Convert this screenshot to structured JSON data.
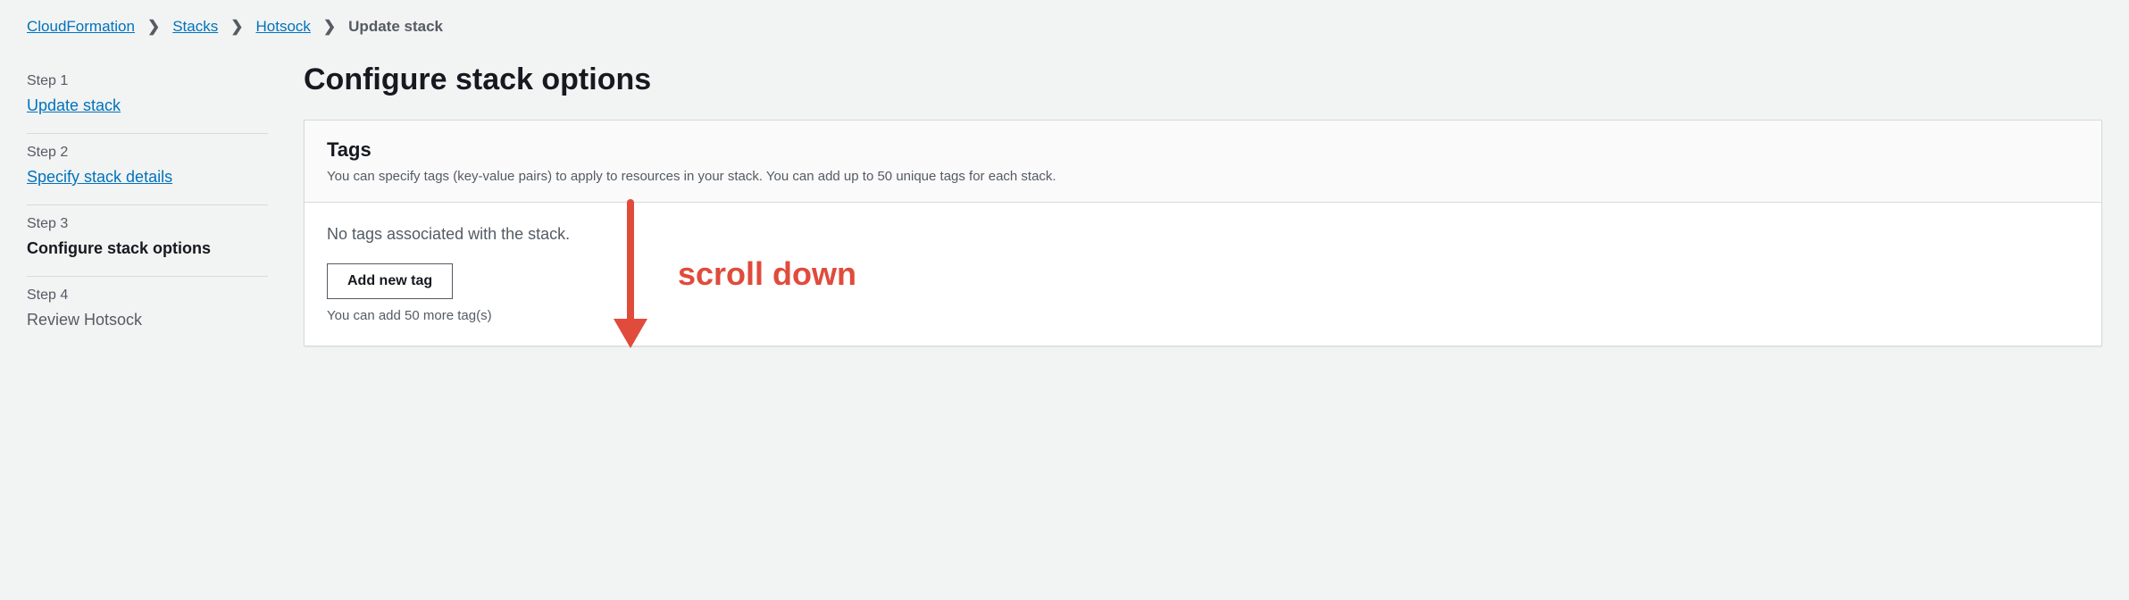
{
  "breadcrumb": {
    "items": [
      {
        "label": "CloudFormation"
      },
      {
        "label": "Stacks"
      },
      {
        "label": "Hotsock"
      }
    ],
    "current": "Update stack"
  },
  "steps": [
    {
      "number": "Step 1",
      "title": "Update stack",
      "state": "link"
    },
    {
      "number": "Step 2",
      "title": "Specify stack details",
      "state": "link"
    },
    {
      "number": "Step 3",
      "title": "Configure stack options",
      "state": "current"
    },
    {
      "number": "Step 4",
      "title": "Review Hotsock",
      "state": "pending"
    }
  ],
  "main": {
    "title": "Configure stack options",
    "tags_panel": {
      "title": "Tags",
      "description": "You can specify tags (key-value pairs) to apply to resources in your stack. You can add up to 50 unique tags for each stack.",
      "empty_message": "No tags associated with the stack.",
      "add_button_label": "Add new tag",
      "helper_text": "You can add 50 more tag(s)"
    }
  },
  "annotation": {
    "text": "scroll down"
  }
}
